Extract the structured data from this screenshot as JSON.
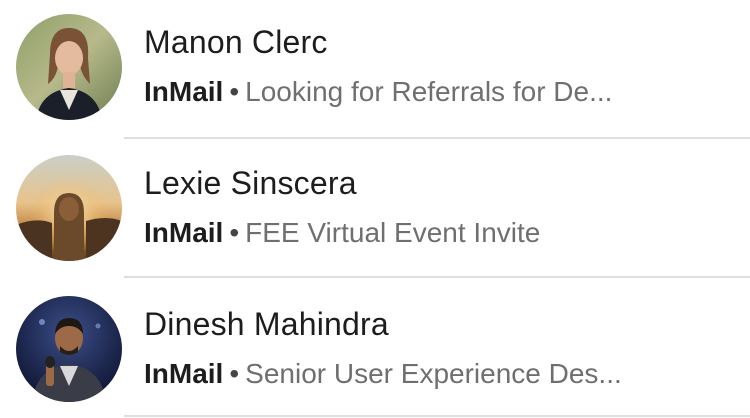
{
  "conversations": [
    {
      "name": "Manon Clerc",
      "tag": "InMail",
      "separator": "•",
      "snippet": "Looking for Referrals for De..."
    },
    {
      "name": "Lexie Sinscera",
      "tag": "InMail",
      "separator": "•",
      "snippet": "FEE Virtual Event Invite"
    },
    {
      "name": "Dinesh Mahindra",
      "tag": "InMail",
      "separator": "•",
      "snippet": "Senior User Experience Des..."
    }
  ]
}
